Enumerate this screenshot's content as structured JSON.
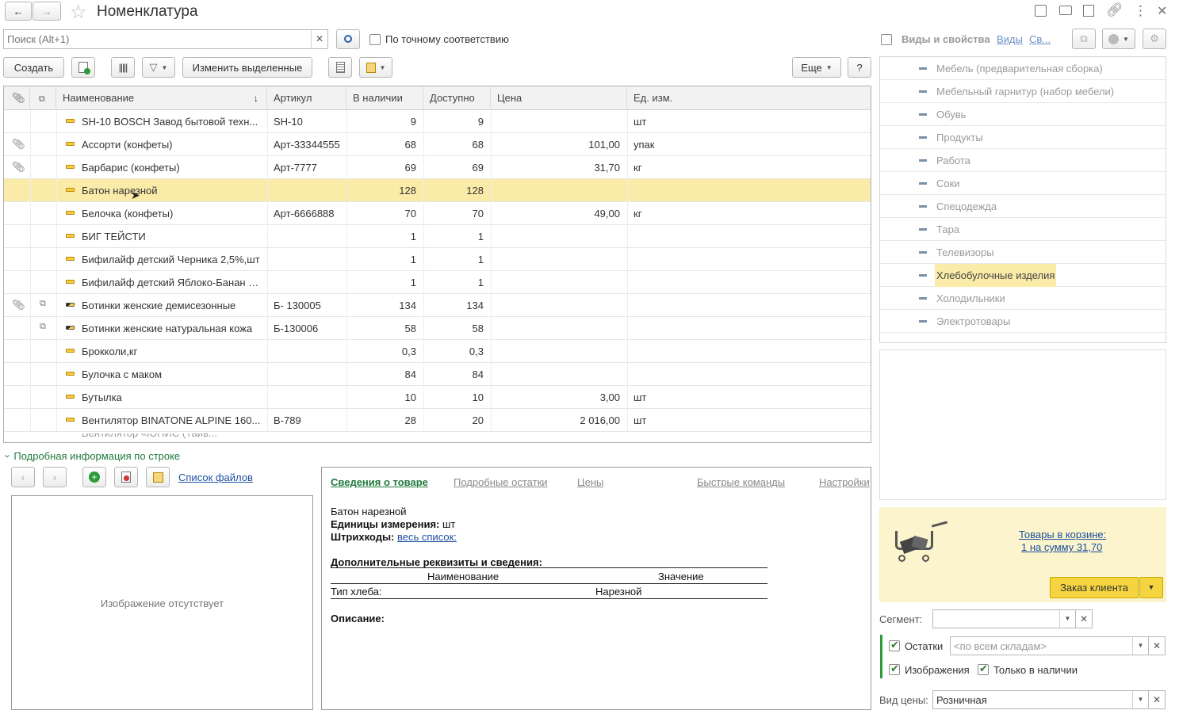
{
  "window": {
    "title": "Номенклатура",
    "nav_back": "←",
    "nav_forward": "→"
  },
  "search": {
    "placeholder": "Поиск (Alt+1)",
    "exact_match_label": "По точному соответствию"
  },
  "toolbar": {
    "create_label": "Создать",
    "change_selected_label": "Изменить выделенные",
    "more_label": "Еще",
    "help_label": "?"
  },
  "table": {
    "columns": [
      "Наименование",
      "Артикул",
      "В наличии",
      "Доступно",
      "Цена",
      "Ед. изм."
    ],
    "sort_indicator": "↓",
    "rows": [
      {
        "name": "SH-10 BOSCH Завод бытовой техн...",
        "article": "SH-10",
        "stock": "9",
        "available": "9",
        "price": "",
        "unit": "шт",
        "attach": false,
        "copy": false,
        "icon": "light"
      },
      {
        "name": "Ассорти (конфеты)",
        "article": "Арт-33344555",
        "stock": "68",
        "available": "68",
        "price": "101,00",
        "unit": "упак",
        "attach": true,
        "copy": false,
        "icon": "light"
      },
      {
        "name": "Барбарис (конфеты)",
        "article": "Арт-7777",
        "stock": "69",
        "available": "69",
        "price": "31,70",
        "unit": "кг",
        "attach": true,
        "copy": false,
        "icon": "light"
      },
      {
        "name": "Батон нарезной",
        "article": "",
        "stock": "128",
        "available": "128",
        "price": "",
        "unit": "",
        "attach": false,
        "copy": false,
        "icon": "light"
      },
      {
        "name": "Белочка (конфеты)",
        "article": "Арт-6666888",
        "stock": "70",
        "available": "70",
        "price": "49,00",
        "unit": "кг",
        "attach": false,
        "copy": false,
        "icon": "light"
      },
      {
        "name": "БИГ ТЕЙСТИ",
        "article": "",
        "stock": "1",
        "available": "1",
        "price": "",
        "unit": "",
        "attach": false,
        "copy": false,
        "icon": "light"
      },
      {
        "name": "Бифилайф детский Черника 2,5%,шт",
        "article": "",
        "stock": "1",
        "available": "1",
        "price": "",
        "unit": "",
        "attach": false,
        "copy": false,
        "icon": "light"
      },
      {
        "name": "Бифилайф детский Яблоко-Банан 2...",
        "article": "",
        "stock": "1",
        "available": "1",
        "price": "",
        "unit": "",
        "attach": false,
        "copy": false,
        "icon": "light"
      },
      {
        "name": "Ботинки женские демисезонные",
        "article": "Б- 130005",
        "stock": "134",
        "available": "134",
        "price": "",
        "unit": "",
        "attach": true,
        "copy": true,
        "icon": "dark"
      },
      {
        "name": "Ботинки женские натуральная кожа",
        "article": "Б-130006",
        "stock": "58",
        "available": "58",
        "price": "",
        "unit": "",
        "attach": false,
        "copy": true,
        "icon": "dark"
      },
      {
        "name": "Брокколи,кг",
        "article": "",
        "stock": "0,3",
        "available": "0,3",
        "price": "",
        "unit": "",
        "attach": false,
        "copy": false,
        "icon": "light"
      },
      {
        "name": "Булочка с маком",
        "article": "",
        "stock": "84",
        "available": "84",
        "price": "",
        "unit": "",
        "attach": false,
        "copy": false,
        "icon": "light"
      },
      {
        "name": "Бутылка",
        "article": "",
        "stock": "10",
        "available": "10",
        "price": "3,00",
        "unit": "шт",
        "attach": false,
        "copy": false,
        "icon": "light"
      },
      {
        "name": "Вентилятор BINATONE ALPINE 160...",
        "article": "В-789",
        "stock": "28",
        "available": "20",
        "price": "2 016,00",
        "unit": "шт",
        "attach": false,
        "copy": false,
        "icon": "light"
      }
    ]
  },
  "details": {
    "toggle_label": "Подробная информация по строке",
    "files_link": "Список файлов",
    "no_image": "Изображение отсутствует",
    "tabs": [
      "Сведения о товаре",
      "Подробные остатки",
      "Цены",
      "Быстрые команды",
      "Настройки"
    ],
    "product_name": "Батон нарезной",
    "units_label": "Единицы измерения:",
    "units_value": "шт",
    "barcodes_label": "Штрихкоды:",
    "barcodes_link": "весь список:",
    "extra_title": "Дополнительные реквизиты и сведения:",
    "extra_col_name": "Наименование",
    "extra_col_value": "Значение",
    "extra_row_name": "Тип хлеба:",
    "extra_row_value": "Нарезной",
    "description_label": "Описание:"
  },
  "right_panel": {
    "kinds_label": "Виды и свойства",
    "kinds_link": "Виды",
    "props_link": "Св...",
    "categories": [
      "Мебель (предварительная сборка)",
      "Мебельный гарнитур (набор мебели)",
      "Обувь",
      "Продукты",
      "Работа",
      "Соки",
      "Спецодежда",
      "Тара",
      "Телевизоры",
      "Хлебобулочные изделия",
      "Холодильники",
      "Электротовары"
    ],
    "selected_category": "Хлебобулочные изделия",
    "cart_line1": "Товары в корзине:",
    "cart_line2": "1 на сумму 31,70",
    "order_button": "Заказ клиента",
    "segment_label": "Сегмент:",
    "stock_label": "Остатки",
    "stock_placeholder": "<по всем складам>",
    "images_label": "Изображения",
    "only_available_label": "Только в наличии",
    "price_type_label": "Вид цены:",
    "price_type_value": "Розничная"
  },
  "colors": {
    "selection": "#fbeba9",
    "accent_yellow": "#f5d53f",
    "green": "#1f7a3c",
    "link": "#1c4fa0"
  }
}
